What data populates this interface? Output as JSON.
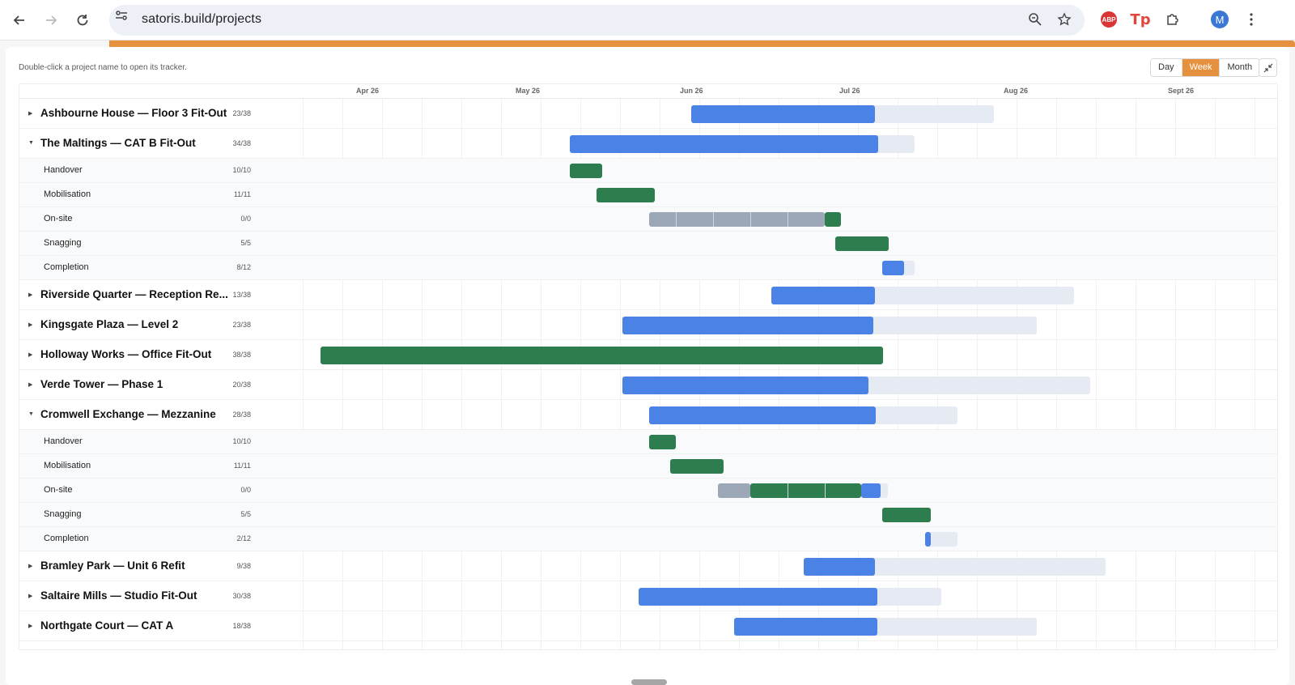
{
  "browser": {
    "url": "satoris.build/projects",
    "avatar_letter": "M",
    "abp_label": "ABP",
    "tp_label": "Tp"
  },
  "toolbar": {
    "hint": "Double-click a project name to open its tracker.",
    "views": [
      "Day",
      "Week",
      "Month"
    ],
    "active_view": "Week"
  },
  "timeline": {
    "months": [
      "Apr 26",
      "May 26",
      "Jun 26",
      "Jul 26",
      "Aug 26",
      "Sept 26"
    ]
  },
  "rows": [
    {
      "kind": "project",
      "expanded": false,
      "name": "Ashbourne House — Floor 3 Fit-Out",
      "count": "23/38"
    },
    {
      "kind": "project",
      "expanded": true,
      "name": "The Maltings — CAT B Fit-Out",
      "count": "34/38"
    },
    {
      "kind": "phase",
      "name": "Handover",
      "count": "10/10"
    },
    {
      "kind": "phase",
      "name": "Mobilisation",
      "count": "11/11"
    },
    {
      "kind": "phase",
      "name": "On-site",
      "count": "0/0"
    },
    {
      "kind": "phase",
      "name": "Snagging",
      "count": "5/5"
    },
    {
      "kind": "phase",
      "name": "Completion",
      "count": "8/12"
    },
    {
      "kind": "project",
      "expanded": false,
      "name": "Riverside Quarter — Reception Re...",
      "count": "13/38"
    },
    {
      "kind": "project",
      "expanded": false,
      "name": "Kingsgate Plaza — Level 2",
      "count": "23/38"
    },
    {
      "kind": "project",
      "expanded": false,
      "name": "Holloway Works — Office Fit-Out",
      "count": "38/38"
    },
    {
      "kind": "project",
      "expanded": false,
      "name": "Verde Tower — Phase 1",
      "count": "20/38"
    },
    {
      "kind": "project",
      "expanded": true,
      "name": "Cromwell Exchange — Mezzanine",
      "count": "28/38"
    },
    {
      "kind": "phase",
      "name": "Handover",
      "count": "10/10"
    },
    {
      "kind": "phase",
      "name": "Mobilisation",
      "count": "11/11"
    },
    {
      "kind": "phase",
      "name": "On-site",
      "count": "0/0"
    },
    {
      "kind": "phase",
      "name": "Snagging",
      "count": "5/5"
    },
    {
      "kind": "phase",
      "name": "Completion",
      "count": "2/12"
    },
    {
      "kind": "project",
      "expanded": false,
      "name": "Bramley Park — Unit 6 Refit",
      "count": "9/38"
    },
    {
      "kind": "project",
      "expanded": false,
      "name": "Saltaire Mills — Studio Fit-Out",
      "count": "30/38"
    },
    {
      "kind": "project",
      "expanded": false,
      "name": "Northgate Court — CAT A",
      "count": "18/38"
    }
  ],
  "colors": {
    "accent": "#e5913f",
    "in_progress": "#4a82e6",
    "complete": "#2e7d4f",
    "not_started": "#9ca8b8",
    "remaining": "#e6eaf3"
  }
}
